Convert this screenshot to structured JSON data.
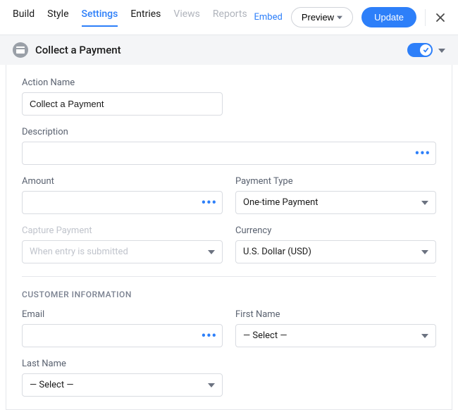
{
  "tabs": {
    "build": "Build",
    "style": "Style",
    "settings": "Settings",
    "entries": "Entries",
    "views": "Views",
    "reports": "Reports"
  },
  "topActions": {
    "embed": "Embed",
    "preview": "Preview",
    "update": "Update"
  },
  "accordion": {
    "title": "Collect a Payment"
  },
  "form": {
    "actionName": {
      "label": "Action Name",
      "value": "Collect a Payment"
    },
    "description": {
      "label": "Description",
      "value": ""
    },
    "amount": {
      "label": "Amount",
      "value": ""
    },
    "paymentType": {
      "label": "Payment Type",
      "value": "One-time Payment"
    },
    "capturePayment": {
      "label": "Capture Payment",
      "placeholder": "When entry is submitted"
    },
    "currency": {
      "label": "Currency",
      "value": "U.S. Dollar (USD)"
    },
    "sectionCustomer": "CUSTOMER INFORMATION",
    "email": {
      "label": "Email",
      "value": ""
    },
    "firstName": {
      "label": "First Name",
      "value": "— Select —"
    },
    "lastName": {
      "label": "Last Name",
      "value": "— Select —"
    }
  }
}
